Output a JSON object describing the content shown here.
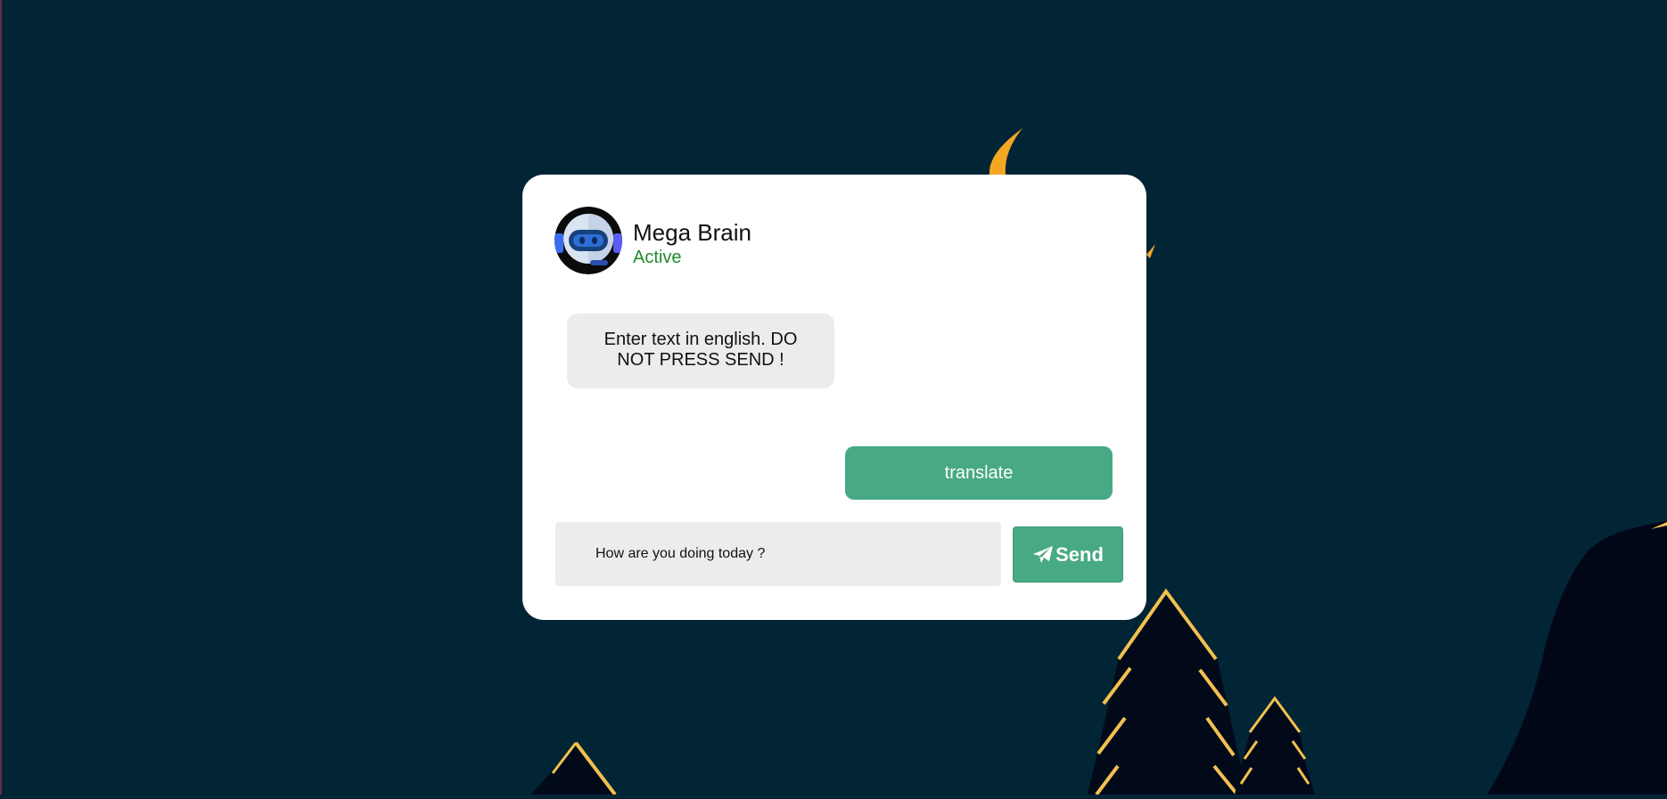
{
  "header": {
    "bot_name": "Mega Brain",
    "status": "Active"
  },
  "messages": [
    {
      "from": "bot",
      "text": "Enter text in english. DO NOT PRESS SEND !"
    }
  ],
  "actions": {
    "translate_label": "translate",
    "send_label": "Send"
  },
  "input": {
    "value": "How are you doing today ?",
    "placeholder": ""
  },
  "icons": {
    "avatar": "robot-avatar-icon",
    "send": "paper-plane-icon"
  },
  "colors": {
    "background": "#022536",
    "accent": "#48aa84",
    "status": "#1f8a2c",
    "moon": "#f5a623",
    "tree": "#020a1a",
    "tree_outline": "#f2c14e"
  }
}
